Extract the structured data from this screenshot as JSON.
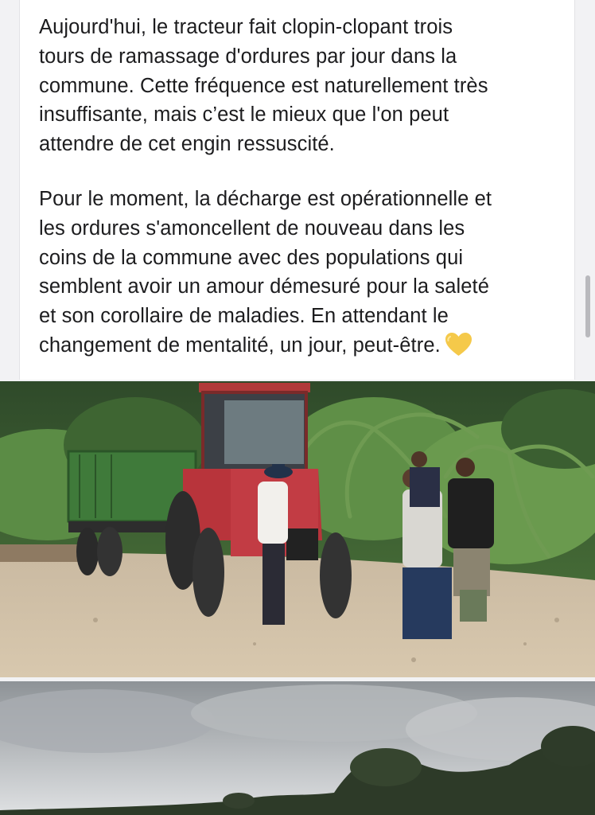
{
  "post": {
    "paragraph1_lines": [
      "Aujourd'hui, le tracteur fait clopin-clopant trois",
      "tours de ramassage d'ordures par jour dans la",
      "commune. Cette fréquence est naturellement très",
      "insuffisante, mais c’est le mieux que l'on peut",
      "attendre de cet engin ressuscité."
    ],
    "paragraph2_lines": [
      "Pour le moment, la décharge est opérationnelle et",
      "les ordures s'amoncellent de nouveau dans les",
      "coins de la commune avec des populations qui",
      "semblent avoir un amour démesuré pour la saleté",
      "et son corollaire de maladies. En attendant le",
      "changement de mentalité, un jour, peut-être."
    ],
    "emoji": "yellow-heart-icon"
  },
  "photos": [
    {
      "subject": "tractor-with-trailer-and-workers-photo"
    },
    {
      "subject": "cloudy-sky-treeline-photo"
    }
  ],
  "colors": {
    "text": "#1c1c1e",
    "heart": "#f5c94a",
    "card_border": "#e3e3e6"
  }
}
